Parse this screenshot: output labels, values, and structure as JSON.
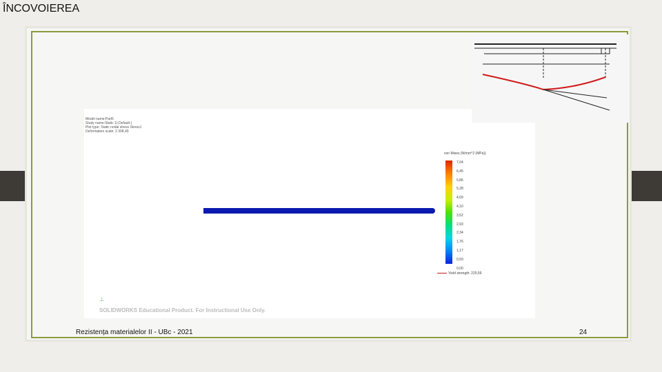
{
  "slide": {
    "title": "ÎNCOVOIEREA",
    "footer": "Rezistența materialelor II - UBc - 2021",
    "page_number": "24"
  },
  "simulation": {
    "meta_lines": [
      "Model name:Part5",
      "Study name:Static 1(-Default-)",
      "Plot type: Static nodal stress Stress1",
      "Deformation scale: 2 308,49"
    ],
    "legend_title": "von Mises (N/mm^2 (MPa))",
    "ticks": [
      "7,04",
      "6,45",
      "5,86",
      "5,28",
      "4,69",
      "4,10",
      "3,52",
      "2,93",
      "2,34",
      "1,76",
      "1,17",
      "0,59",
      "0,00"
    ],
    "yield_label": "Yield strength: 220,59",
    "watermark": "SOLIDWORKS Educational Product. For Instructional Use Only."
  },
  "diagram": {
    "support_labels": [
      "1",
      "2",
      "3"
    ],
    "labels": [
      "a",
      "l",
      "v2",
      "v",
      "φ2'",
      "φ2''",
      "α2",
      "t2''",
      "t2'",
      "M0"
    ]
  }
}
